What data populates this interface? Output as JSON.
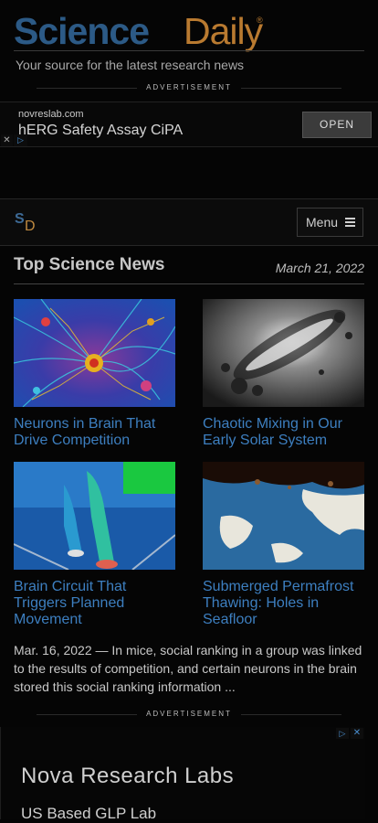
{
  "header": {
    "logo_science": "Science",
    "logo_daily": "Daily",
    "logo_mark": "®",
    "tagline": "Your source for the latest research news"
  },
  "ad_top": {
    "label": "ADVERTISEMENT",
    "domain": "novreslab.com",
    "title": "hERG Safety Assay CiPA",
    "cta": "OPEN",
    "close_glyph": "✕",
    "info_glyph": "▷"
  },
  "nav": {
    "logo_s": "S",
    "logo_d": "D",
    "menu_label": "Menu"
  },
  "section": {
    "title": "Top Science News",
    "date": "March 21, 2022"
  },
  "articles": [
    {
      "title": "Neurons in Brain That Drive Competition"
    },
    {
      "title": "Chaotic Mixing in Our Early Solar System"
    },
    {
      "title": "Brain Circuit That Triggers Planned Movement"
    },
    {
      "title": "Submerged Permafrost Thawing: Holes in Seafloor"
    }
  ],
  "summary": "Mar. 16, 2022 — In mice, social ranking in a group was linked to the results of competition, and certain neurons in the brain stored this social ranking information ...",
  "ad_bottom": {
    "label": "ADVERTISEMENT",
    "name": "Nova Research Labs",
    "subtitle": "US Based GLP Lab",
    "info_glyph": "▷",
    "close_glyph": "✕"
  },
  "colors": {
    "brand_blue": "#2c5a86",
    "brand_orange": "#b97a30",
    "link": "#3d7fc0"
  }
}
